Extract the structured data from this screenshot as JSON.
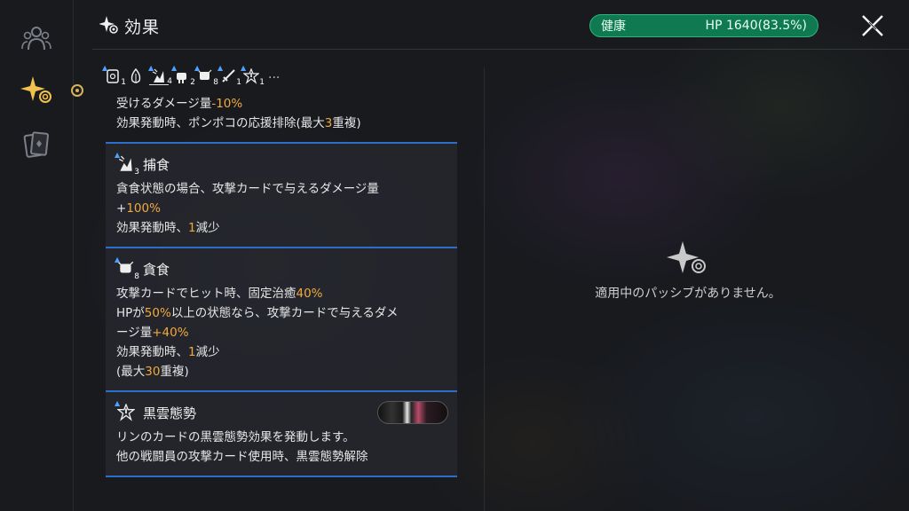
{
  "header": {
    "title": "効果",
    "title_icon": "sparkle-swirl-icon",
    "status_label": "健康",
    "hp_text": "HP 1640(83.5%)",
    "hp_color": "#0f7a52",
    "close_icon": "close-x-icon"
  },
  "rail": {
    "items": [
      {
        "name": "party",
        "icon": "party-members-icon",
        "active": false
      },
      {
        "name": "effects",
        "icon": "sparkle-swirl-icon",
        "active": true
      },
      {
        "name": "cards",
        "icon": "card-deck-icon",
        "active": false
      }
    ]
  },
  "effect_strip": {
    "items": [
      {
        "icon": "scroll-icon",
        "count": "1",
        "buff": true
      },
      {
        "icon": "flame-leaf-icon",
        "count": "",
        "buff": false
      },
      {
        "icon": "predation-icon",
        "count": "4",
        "buff": true,
        "selected": true
      },
      {
        "icon": "fist-shield-icon",
        "count": "2",
        "buff": true
      },
      {
        "icon": "devour-icon",
        "count": "8",
        "buff": true
      },
      {
        "icon": "sword-icon",
        "count": "1",
        "buff": true
      },
      {
        "icon": "black-cloud-icon",
        "count": "1",
        "buff": true
      }
    ],
    "more": "···"
  },
  "effects": {
    "first": {
      "line1_a": "受けるダメージ量",
      "line1_b": "-10%",
      "line2_a": "効果発動時、ポンポコの応援排除(最大",
      "line2_b": "3",
      "line2_c": "重複)"
    },
    "hoshoku": {
      "name": "捕食",
      "count": "3",
      "l1": "貪食状態の場合、攻撃カードで与えるダメージ量",
      "l2a": "+",
      "l2b": "100%",
      "l3a": "効果発動時、",
      "l3b": "1",
      "l3c": "減少"
    },
    "donshoku": {
      "name": "貪食",
      "count": "8",
      "l1a": "攻撃カードでヒット時、固定治癒",
      "l1b": "40%",
      "l2a": "HPが",
      "l2b": "50%",
      "l2c": "以上の状態なら、攻撃カードで与えるダメ",
      "l3a": "ージ量",
      "l3b": "+40%",
      "l4a": "効果発動時、",
      "l4b": "1",
      "l4c": "減少",
      "l5a": "(最大",
      "l5b": "30",
      "l5c": "重複)"
    },
    "kokuun": {
      "name": "黒雲態勢",
      "l1": "リンのカードの黒雲態勢効果を発動します。",
      "l2": "他の戦闘員の攻撃カード使用時、黒雲態勢解除"
    }
  },
  "passive": {
    "empty_text": "適用中のパッシブがありません。",
    "icon": "sparkle-swirl-icon"
  }
}
